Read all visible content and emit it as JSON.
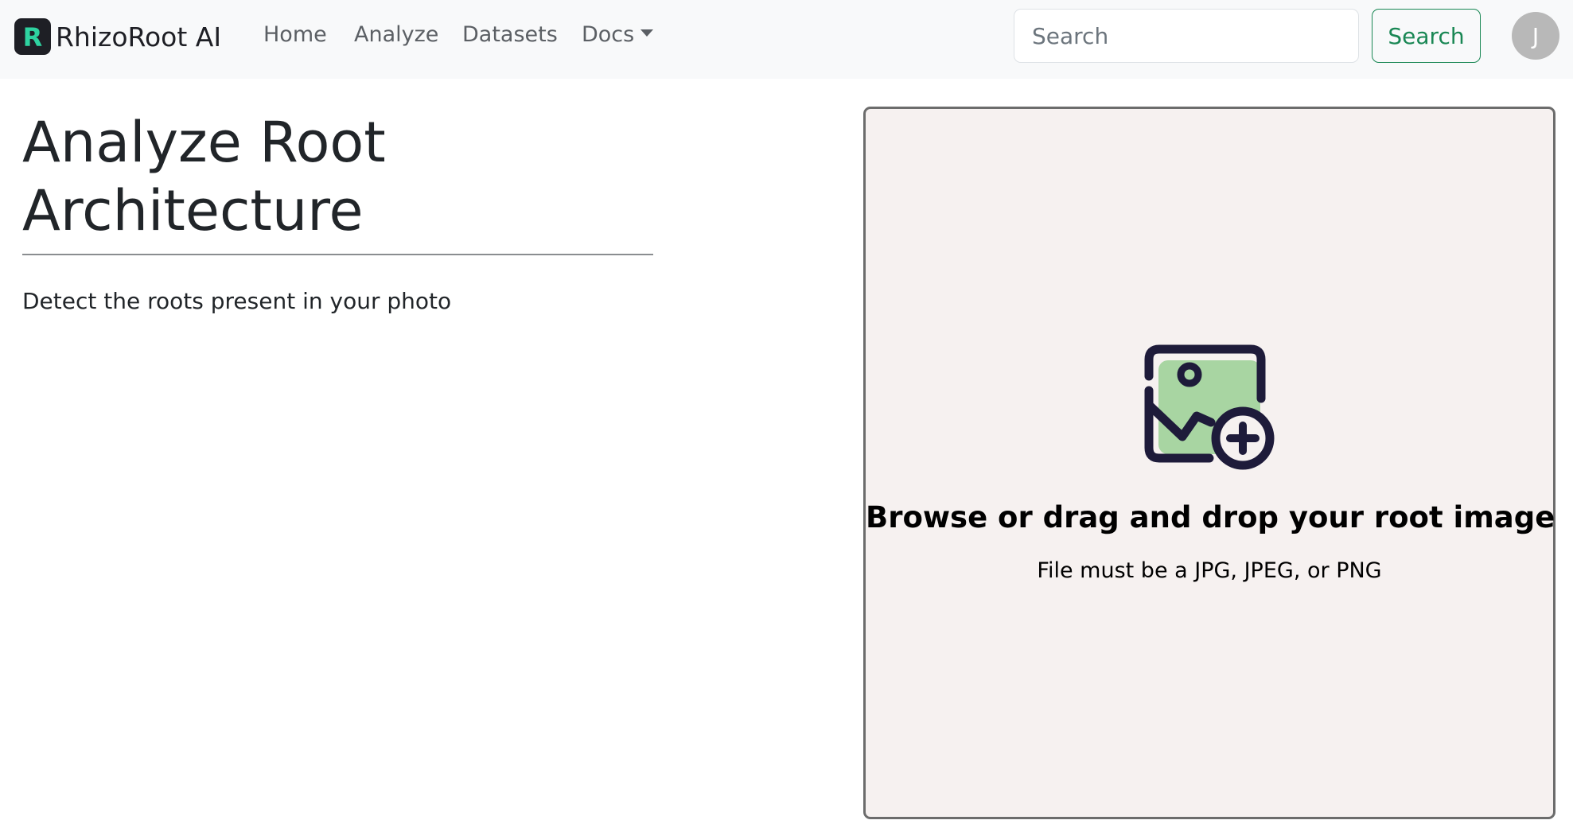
{
  "navbar": {
    "brand": {
      "logo_letter": "R",
      "name": "RhizoRoot AI",
      "logo_bg": "#1e1f25",
      "logo_accent": "#2ed3a0"
    },
    "links": [
      {
        "label": "Home"
      },
      {
        "label": "Analyze"
      },
      {
        "label": "Datasets"
      },
      {
        "label": "Docs",
        "has_dropdown": true
      }
    ],
    "search": {
      "placeholder": "Search",
      "value": "",
      "button_label": "Search",
      "button_color": "#198754"
    },
    "avatar": {
      "initial": "J"
    }
  },
  "main": {
    "title": "Analyze Root Architecture",
    "subtitle": "Detect the roots present in your photo"
  },
  "dropzone": {
    "icon": "image-add-icon",
    "title": "Browse or drag and drop your root image",
    "hint": "File must be a JPG, JPEG, or PNG",
    "icon_accent": "#a8d5a2",
    "icon_stroke": "#1e1b3a"
  }
}
